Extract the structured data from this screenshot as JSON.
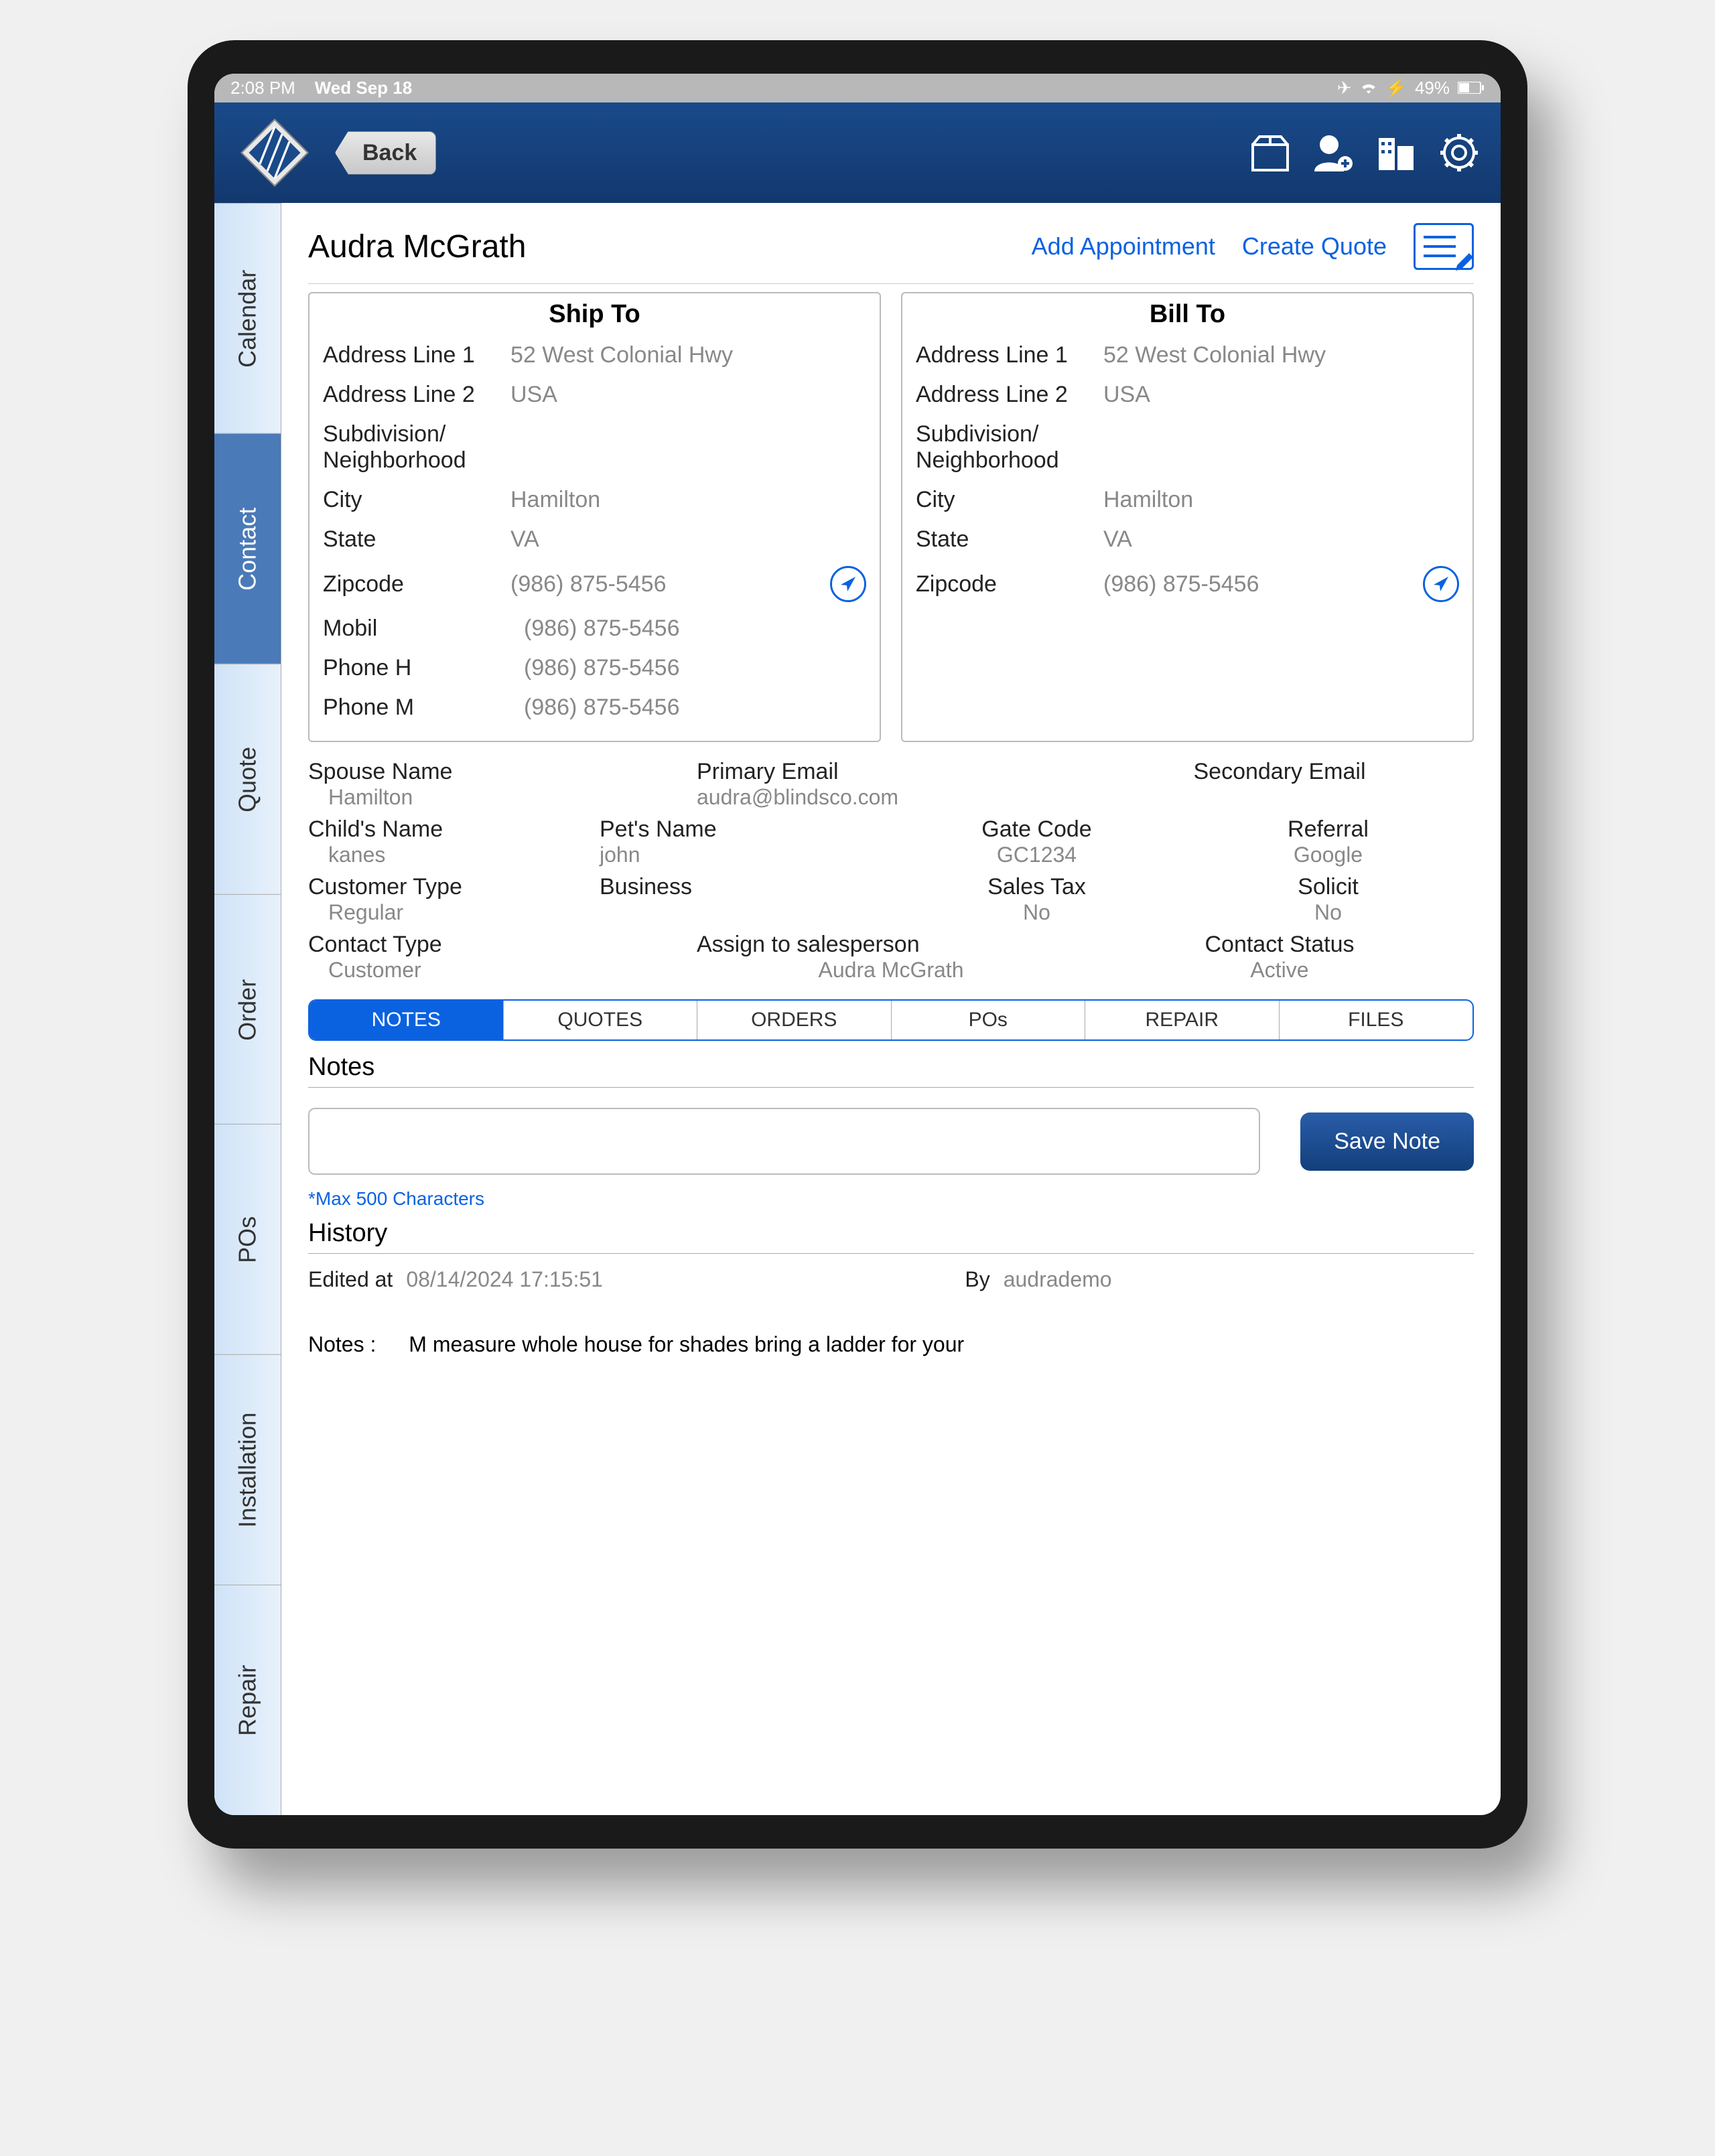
{
  "status": {
    "time": "2:08 PM",
    "date": "Wed Sep 18",
    "battery": "49%"
  },
  "topbar": {
    "back": "Back"
  },
  "sidebar": {
    "items": [
      {
        "label": "Calendar"
      },
      {
        "label": "Contact"
      },
      {
        "label": "Quote"
      },
      {
        "label": "Order"
      },
      {
        "label": "POs"
      },
      {
        "label": "Installation"
      },
      {
        "label": "Repair"
      }
    ]
  },
  "header": {
    "customer_name": "Audra McGrath",
    "add_appt": "Add Appointment",
    "create_quote": "Create Quote"
  },
  "ship_to": {
    "title": "Ship To",
    "addr1_lbl": "Address Line 1",
    "addr1": "52 West Colonial Hwy",
    "addr2_lbl": "Address Line 2",
    "addr2": "USA",
    "sub_lbl": "Subdivision/ Neighborhood",
    "sub": "",
    "city_lbl": "City",
    "city": "Hamilton",
    "state_lbl": "State",
    "state": "VA",
    "zip_lbl": "Zipcode",
    "zip": "(986) 875-5456",
    "mobil_lbl": "Mobil",
    "mobil": "(986) 875-5456",
    "phoneh_lbl": "Phone H",
    "phoneh": "(986) 875-5456",
    "phonem_lbl": "Phone M",
    "phonem": "(986) 875-5456"
  },
  "bill_to": {
    "title": "Bill To",
    "addr1_lbl": "Address Line 1",
    "addr1": "52 West Colonial Hwy",
    "addr2_lbl": "Address Line 2",
    "addr2": "USA",
    "sub_lbl": "Subdivision/ Neighborhood",
    "sub": "",
    "city_lbl": "City",
    "city": "Hamilton",
    "state_lbl": "State",
    "state": "VA",
    "zip_lbl": "Zipcode",
    "zip": "(986) 875-5456"
  },
  "details": {
    "spouse_lbl": "Spouse Name",
    "spouse": "Hamilton",
    "primary_email_lbl": "Primary Email",
    "primary_email": "audra@blindsco.com",
    "secondary_email_lbl": "Secondary Email",
    "secondary_email": "",
    "child_lbl": "Child's Name",
    "child": "kanes",
    "pet_lbl": "Pet's Name",
    "pet": "john",
    "gate_lbl": "Gate Code",
    "gate": "GC1234",
    "referral_lbl": "Referral",
    "referral": "Google",
    "custtype_lbl": "Customer Type",
    "custtype": "Regular",
    "business_lbl": "Business",
    "business": "",
    "salestax_lbl": "Sales Tax",
    "salestax": "No",
    "solicit_lbl": "Solicit",
    "solicit": "No",
    "contacttype_lbl": "Contact Type",
    "contacttype": "Customer",
    "assign_lbl": "Assign to salesperson",
    "assign": "Audra McGrath",
    "status_lbl": "Contact Status",
    "status": "Active"
  },
  "subtabs": {
    "notes": "NOTES",
    "quotes": "QUOTES",
    "orders": "ORDERS",
    "pos": "POs",
    "repair": "REPAIR",
    "files": "FILES"
  },
  "notes": {
    "title": "Notes",
    "max": "*Max 500 Characters",
    "save": "Save Note",
    "history_title": "History",
    "edited_lbl": "Edited at",
    "edited_val": "08/14/2024 17:15:51",
    "by_lbl": "By",
    "by_val": "audrademo",
    "notes_lbl": "Notes :",
    "notes_body": "M measure whole house for shades bring a ladder for your"
  }
}
